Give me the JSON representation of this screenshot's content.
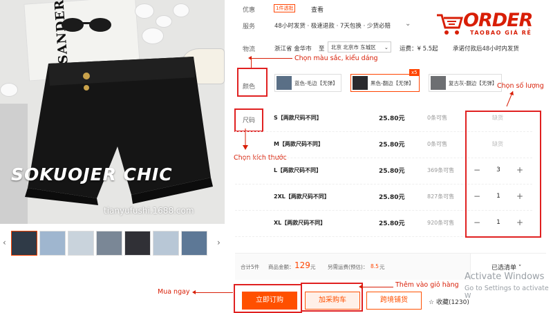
{
  "watermark": "tianyufushi.1688.com",
  "product_brand": "SOKUOJER CHIC",
  "magazine_title": "JIL SANDER",
  "logo": {
    "word": "ORDER",
    "sub": "TAOBAO GIÁ RẺ"
  },
  "info": {
    "youhui": {
      "label": "优惠",
      "badge": "1件透批",
      "link": "查看"
    },
    "service": {
      "label": "服务",
      "text": "48小时发货 · 极速退款 · 7天包换 · 少货必赔",
      "chevron": "⌄"
    },
    "logistics": {
      "label": "物流",
      "origin": "浙江省 金华市",
      "to": "至",
      "dest": "北京 北京市 东城区",
      "fee": "运费：¥ 5.5起",
      "promise": "承诺付款后48小时内发货"
    }
  },
  "color": {
    "label": "颜色",
    "options": [
      {
        "label": "蓝色-毛边【无弹】",
        "swatch": "#5a6f86"
      },
      {
        "label": "黑色-翻边【无弹】",
        "swatch": "#2a2a2e"
      },
      {
        "label": "复古灰-翻边【无弹】",
        "swatch": "#6d6f72"
      }
    ],
    "selected_count": "x5"
  },
  "size": {
    "label": "尺码",
    "rows": [
      {
        "name": "S【两款尺码不同】",
        "price": "25.80元",
        "stock": "0条可售",
        "qty": "",
        "status": "缺货"
      },
      {
        "name": "M【两款尺码不同】",
        "price": "25.80元",
        "stock": "0条可售",
        "qty": "",
        "status": "缺货"
      },
      {
        "name": "L【两款尺码不同】",
        "price": "25.80元",
        "stock": "369条可售",
        "qty": "3",
        "status": ""
      },
      {
        "name": "2XL【两款尺码不同】",
        "price": "25.80元",
        "stock": "827条可售",
        "qty": "1",
        "status": ""
      },
      {
        "name": "XL【两款尺码不同】",
        "price": "25.80元",
        "stock": "920条可售",
        "qty": "1",
        "status": ""
      }
    ]
  },
  "summary": {
    "total_count": "合计5件",
    "goods_label": "商品金额：",
    "goods_amount": "129",
    "goods_unit": "元",
    "freight_label": "另需运费(预估)：",
    "freight": "8.5",
    "freight_unit": "元",
    "selected_list": "已选清单 ˅"
  },
  "buttons": {
    "buy_now": "立即订购",
    "add_cart": "加采购车",
    "cross_border": "跨境铺货",
    "favorite": "收藏(1230)"
  },
  "annotations": {
    "choose_color": "Chọn màu sắc, kiểu dáng",
    "choose_qty": "Chọn số lượng",
    "choose_size": "Chọn kích thước",
    "buy_now": "Mua ngay",
    "add_cart": "Thêm vào giỏ hàng"
  },
  "os": {
    "activate_title": "Activate Windows",
    "activate_sub": "Go to Settings to activate W"
  },
  "colors": {
    "accent": "#ff5000",
    "annotation": "#d81e06"
  }
}
